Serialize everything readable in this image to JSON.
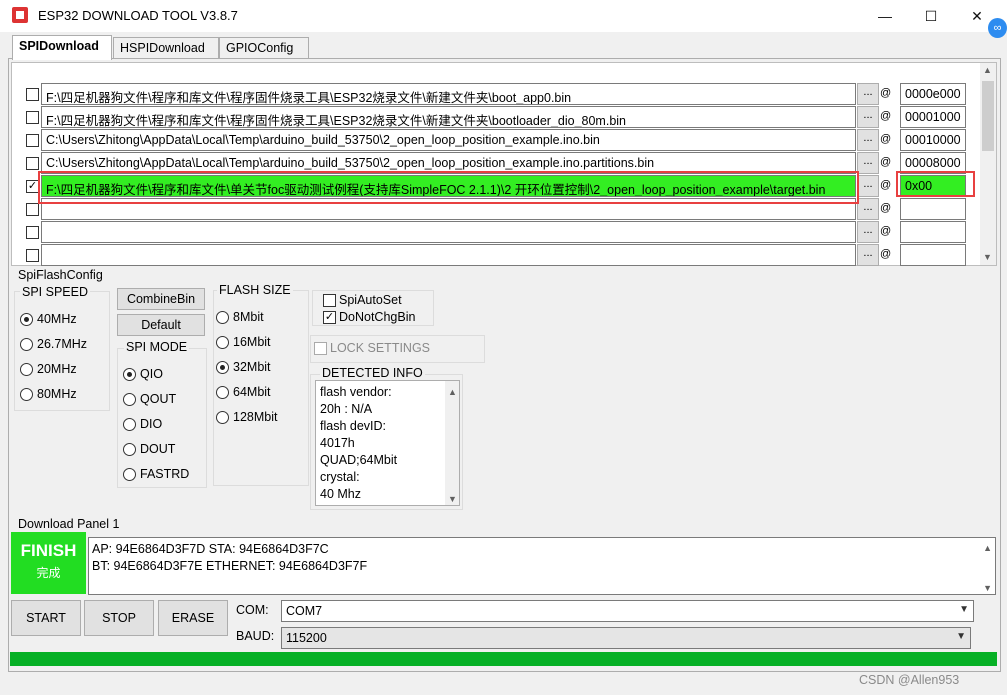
{
  "window": {
    "title": "ESP32 DOWNLOAD TOOL V3.8.7",
    "minimize": "—",
    "maximize": "☐",
    "close": "✕"
  },
  "tabs": [
    {
      "label": "SPIDownload"
    },
    {
      "label": "HSPIDownload"
    },
    {
      "label": "GPIOConfig"
    }
  ],
  "files": [
    {
      "checked": false,
      "path": "F:\\四足机器狗文件\\程序和库文件\\程序固件烧录工具\\ESP32烧录文件\\新建文件夹\\boot_app0.bin",
      "browse": "...",
      "at": "@",
      "addr": "0000e000"
    },
    {
      "checked": false,
      "path": "F:\\四足机器狗文件\\程序和库文件\\程序固件烧录工具\\ESP32烧录文件\\新建文件夹\\bootloader_dio_80m.bin",
      "browse": "...",
      "at": "@",
      "addr": "00001000"
    },
    {
      "checked": false,
      "path": "C:\\Users\\Zhitong\\AppData\\Local\\Temp\\arduino_build_53750\\2_open_loop_position_example.ino.bin",
      "browse": "...",
      "at": "@",
      "addr": "00010000"
    },
    {
      "checked": false,
      "path": "C:\\Users\\Zhitong\\AppData\\Local\\Temp\\arduino_build_53750\\2_open_loop_position_example.ino.partitions.bin",
      "browse": "...",
      "at": "@",
      "addr": "00008000"
    },
    {
      "checked": true,
      "path": "F:\\四足机器狗文件\\程序和库文件\\单关节foc驱动测试例程(支持库SimpleFOC 2.1.1)\\2 开环位置控制\\2_open_loop_position_example\\target.bin",
      "browse": "...",
      "at": "@",
      "addr": "0x00"
    },
    {
      "checked": false,
      "path": "",
      "browse": "...",
      "at": "@",
      "addr": ""
    },
    {
      "checked": false,
      "path": "",
      "browse": "...",
      "at": "@",
      "addr": ""
    },
    {
      "checked": false,
      "path": "",
      "browse": "...",
      "at": "@",
      "addr": ""
    }
  ],
  "spi_flash_config": {
    "label": "SpiFlashConfig",
    "spi_speed": {
      "label": "SPI SPEED",
      "options": [
        "40MHz",
        "26.7MHz",
        "20MHz",
        "80MHz"
      ],
      "selected": "40MHz"
    },
    "combine_bin": "CombineBin",
    "default": "Default",
    "spi_mode": {
      "label": "SPI MODE",
      "options": [
        "QIO",
        "QOUT",
        "DIO",
        "DOUT",
        "FASTRD"
      ],
      "selected": "QIO"
    },
    "flash_size": {
      "label": "FLASH SIZE",
      "options": [
        "8Mbit",
        "16Mbit",
        "32Mbit",
        "64Mbit",
        "128Mbit"
      ],
      "selected": "32Mbit"
    },
    "spi_auto_set": {
      "label": "SpiAutoSet",
      "checked": false
    },
    "do_not_chg_bin": {
      "label": "DoNotChgBin",
      "checked": true
    },
    "lock_settings": {
      "label": "LOCK SETTINGS",
      "checked": false
    },
    "detected_info": {
      "label": "DETECTED INFO",
      "lines": [
        "flash vendor:",
        "20h : N/A",
        "flash devID:",
        "4017h",
        "QUAD;64Mbit",
        "crystal:",
        "40 Mhz"
      ]
    }
  },
  "download_panel": {
    "label": "Download Panel 1",
    "status": "FINISH",
    "status_cn": "完成",
    "log": [
      "AP:  94E6864D3F7D  STA:  94E6864D3F7C",
      "BT:  94E6864D3F7E  ETHERNET:  94E6864D3F7F"
    ],
    "start": "START",
    "stop": "STOP",
    "erase": "ERASE",
    "com_label": "COM:",
    "com_value": "COM7",
    "baud_label": "BAUD:",
    "baud_value": "115200",
    "progress": 1.0
  },
  "watermark": "CSDN @Allen953",
  "colors": {
    "highlight": "#33ee22",
    "finish": "#22dd22",
    "progress": "#06b025",
    "annotation": "#e84040"
  }
}
